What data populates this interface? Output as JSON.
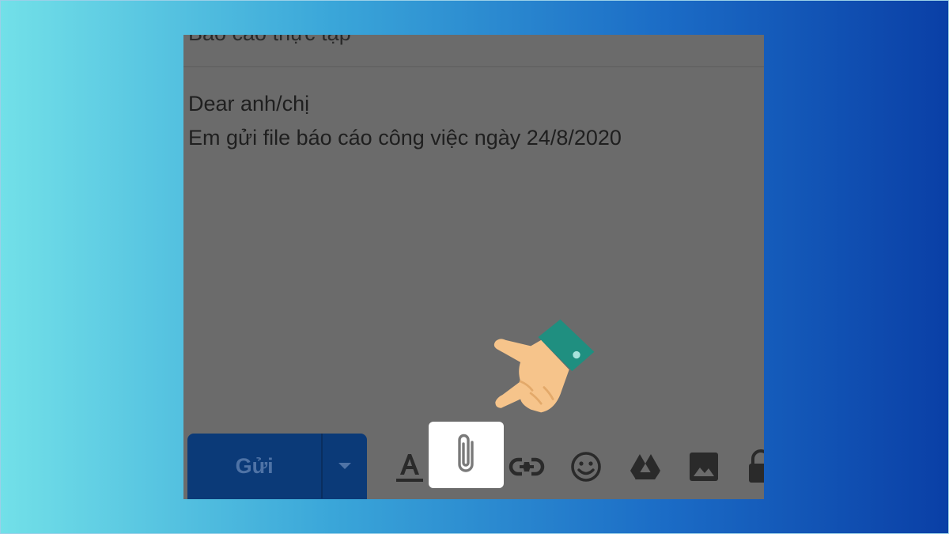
{
  "email": {
    "subject": "Báo cáo thực tập",
    "body_lines": [
      "Dear anh/chị",
      "Em gửi file báo cáo công việc ngày 24/8/2020"
    ]
  },
  "toolbar": {
    "send_label": "Gửi",
    "icons": [
      "format-text-icon",
      "attach-icon",
      "link-icon",
      "emoji-icon",
      "drive-icon",
      "image-icon",
      "lock-icon"
    ]
  },
  "colors": {
    "send_button": "#0b3a78",
    "overlay": "#6b6b6b",
    "highlight": "#ffffff",
    "cuff": "#1f8f80",
    "hand": "#f6c48b"
  }
}
